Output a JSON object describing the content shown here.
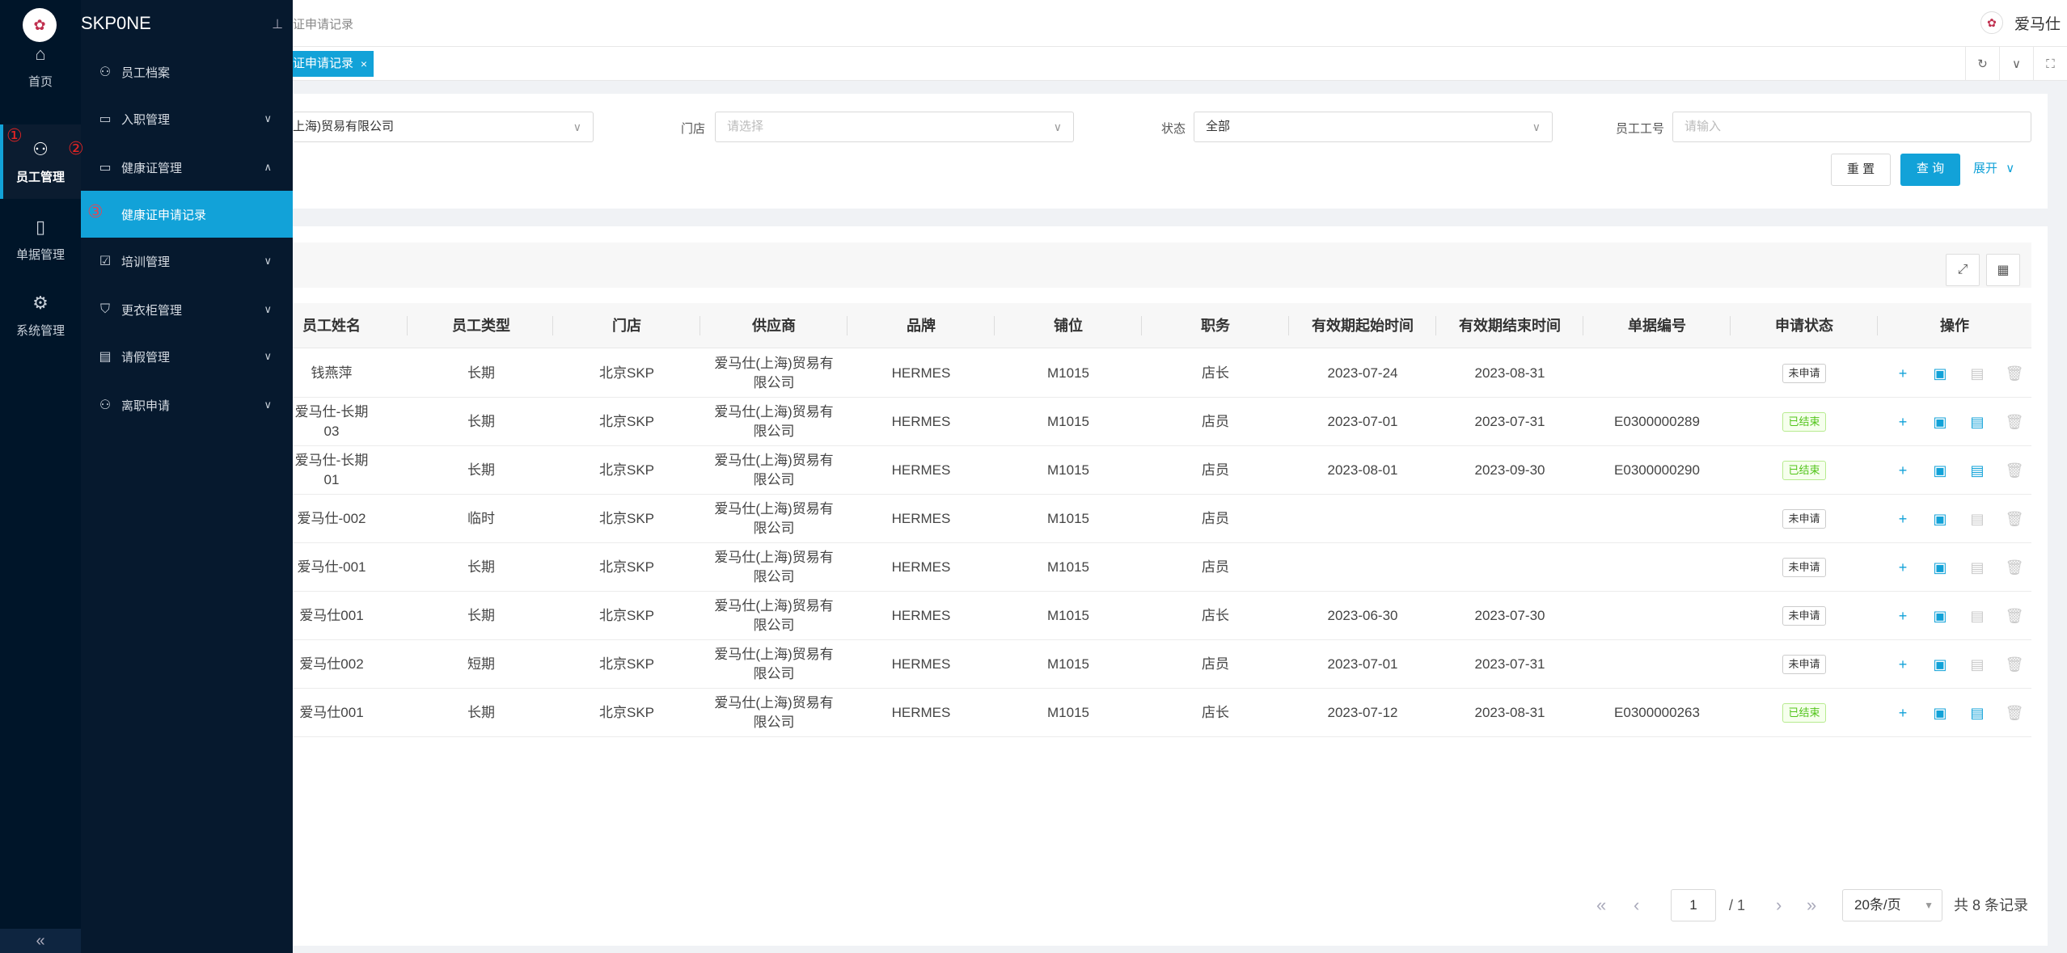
{
  "app": {
    "name": "SKP0NE",
    "user": "爱马仕"
  },
  "rail": [
    {
      "label": "首页",
      "icon": "home-icon"
    },
    {
      "label": "员工管理",
      "icon": "user-icon",
      "active": true
    },
    {
      "label": "单据管理",
      "icon": "document-icon"
    },
    {
      "label": "系统管理",
      "icon": "gear-icon"
    }
  ],
  "submenu": [
    {
      "label": "员工档案",
      "icon": "people-icon",
      "chevron": false
    },
    {
      "label": "入职管理",
      "icon": "id-card-icon",
      "chevron": true
    },
    {
      "label": "健康证管理",
      "icon": "id-card-icon",
      "chevron": true,
      "expanded": true
    },
    {
      "label": "健康证申请记录",
      "icon": "",
      "chevron": false,
      "active": true
    },
    {
      "label": "培训管理",
      "icon": "calendar-check-icon",
      "chevron": true
    },
    {
      "label": "更衣柜管理",
      "icon": "shirt-icon",
      "chevron": true
    },
    {
      "label": "请假管理",
      "icon": "leave-icon",
      "chevron": true
    },
    {
      "label": "离职申请",
      "icon": "user-leave-icon",
      "chevron": true
    }
  ],
  "markers": [
    "①",
    "②",
    "③"
  ],
  "header": {
    "breadcrumb": "证申请记录"
  },
  "tab": {
    "label": "证申请记录",
    "close": "×"
  },
  "filters": {
    "company_value": "上海)贸易有限公司",
    "store_label": "门店",
    "store_placeholder": "请选择",
    "status_label": "状态",
    "status_value": "全部",
    "empno_label": "员工工号",
    "empno_placeholder": "请输入",
    "reset": "重 置",
    "query": "查 询",
    "expand": "展开"
  },
  "table": {
    "columns": [
      "员工姓名",
      "员工类型",
      "门店",
      "供应商",
      "品牌",
      "铺位",
      "职务",
      "有效期起始时间",
      "有效期结束时间",
      "单据编号",
      "申请状态",
      "操作"
    ],
    "rows": [
      {
        "name": "钱燕萍",
        "type": "长期",
        "store": "北京SKP",
        "supplier": "爱马仕(上海)贸易有限公司",
        "brand": "HERMES",
        "berth": "M1015",
        "post": "店长",
        "start": "2023-07-24",
        "end": "2023-08-31",
        "doc": "",
        "status": "未申请",
        "done": false
      },
      {
        "name": "爱马仕-长期03",
        "type": "长期",
        "store": "北京SKP",
        "supplier": "爱马仕(上海)贸易有限公司",
        "brand": "HERMES",
        "berth": "M1015",
        "post": "店员",
        "start": "2023-07-01",
        "end": "2023-07-31",
        "doc": "E0300000289",
        "status": "已结束",
        "done": true
      },
      {
        "name": "爱马仕-长期01",
        "type": "长期",
        "store": "北京SKP",
        "supplier": "爱马仕(上海)贸易有限公司",
        "brand": "HERMES",
        "berth": "M1015",
        "post": "店员",
        "start": "2023-08-01",
        "end": "2023-09-30",
        "doc": "E0300000290",
        "status": "已结束",
        "done": true
      },
      {
        "name": "爱马仕-002",
        "type": "临时",
        "store": "北京SKP",
        "supplier": "爱马仕(上海)贸易有限公司",
        "brand": "HERMES",
        "berth": "M1015",
        "post": "店员",
        "start": "",
        "end": "",
        "doc": "",
        "status": "未申请",
        "done": false
      },
      {
        "name": "爱马仕-001",
        "type": "长期",
        "store": "北京SKP",
        "supplier": "爱马仕(上海)贸易有限公司",
        "brand": "HERMES",
        "berth": "M1015",
        "post": "店员",
        "start": "",
        "end": "",
        "doc": "",
        "status": "未申请",
        "done": false
      },
      {
        "name": "爱马仕001",
        "type": "长期",
        "store": "北京SKP",
        "supplier": "爱马仕(上海)贸易有限公司",
        "brand": "HERMES",
        "berth": "M1015",
        "post": "店长",
        "start": "2023-06-30",
        "end": "2023-07-30",
        "doc": "",
        "status": "未申请",
        "done": false
      },
      {
        "name": "爱马仕002",
        "type": "短期",
        "store": "北京SKP",
        "supplier": "爱马仕(上海)贸易有限公司",
        "brand": "HERMES",
        "berth": "M1015",
        "post": "店员",
        "start": "2023-07-01",
        "end": "2023-07-31",
        "doc": "",
        "status": "未申请",
        "done": false
      },
      {
        "name": "爱马仕001",
        "type": "长期",
        "store": "北京SKP",
        "supplier": "爱马仕(上海)贸易有限公司",
        "brand": "HERMES",
        "berth": "M1015",
        "post": "店长",
        "start": "2023-07-12",
        "end": "2023-08-31",
        "doc": "E0300000263",
        "status": "已结束",
        "done": true
      }
    ]
  },
  "pagination": {
    "page": "1",
    "total_pages": "/ 1",
    "page_size": "20条/页",
    "total": "共 8 条记录"
  }
}
